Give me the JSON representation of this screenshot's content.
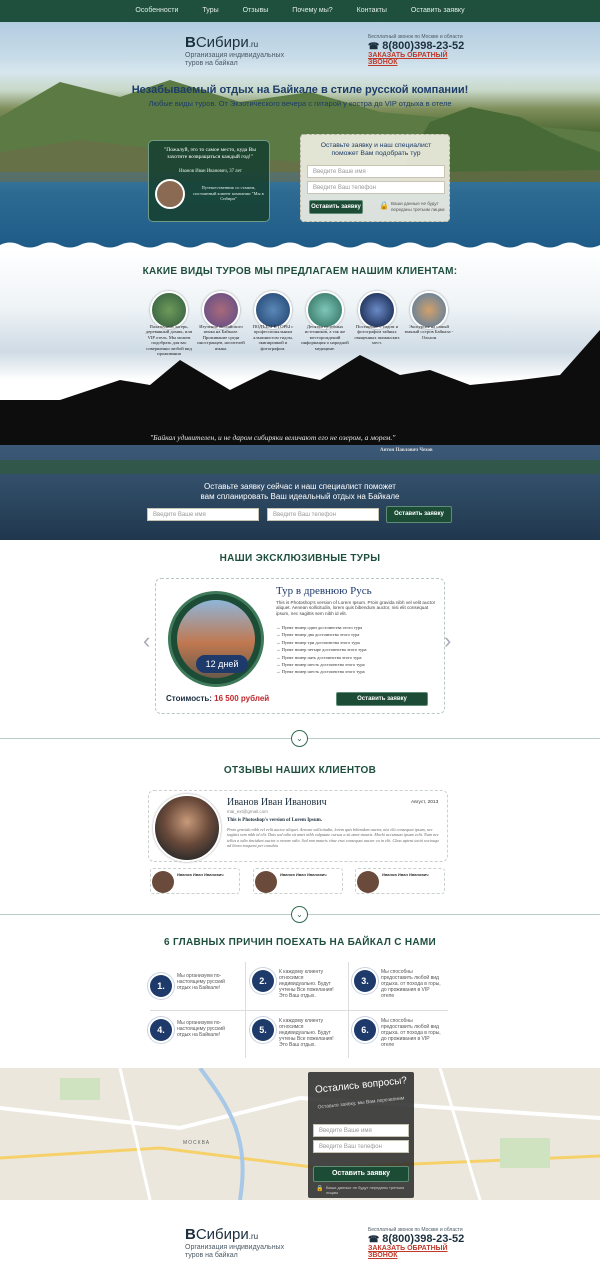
{
  "nav": [
    "Особенности",
    "Туры",
    "Отзывы",
    "Почему мы?",
    "Контакты",
    "Оставить заявку"
  ],
  "brand": {
    "b": "В",
    "name": "Сибири",
    "ru": ".ru",
    "tag1": "Организация индивидуальных",
    "tag2": "туров на байкал",
    "phone_note": "Бесплатный звонок по Москве и области",
    "phone": "8(800)398-23-52",
    "callback": "ЗАКАЗАТЬ ОБРАТНЫЙ ЗВОНОК"
  },
  "hero": {
    "title": "Незабываемый отдых на Байкале в стиле русской компании!",
    "subtitle": "Любые виды туров. От Экзотического вечера с гитарой у костра до VIP отдыха в отеле",
    "quote": "\"Пожалуй, это то самое место, куда Вы захотите возвращаться каждый год!\"",
    "person": "Иванов Иван Иванович, 37 лет",
    "person_desc": "Путешественник со стажем, постоянный клиент компании \"Мы в Сибири\"",
    "form_title": "Оставьте заявку и наш специалист поможет Вам подобрать тур",
    "name_ph": "Введите Ваше имя",
    "phone_ph": "Введите Ваш телефон",
    "button": "Оставить заявку",
    "privacy": "Ваши данные не будут переданы третьим лицам"
  },
  "tours_section": {
    "title": "КАКИЕ ВИДЫ ТУРОВ МЫ ПРЕДЛАГАЕМ НАШИМ КЛИЕНТАМ:",
    "items": [
      "Палаточный лагерь, деревянный домик, или VIP отель. Мы можем подобрать для вас совершенно любой вид проживания",
      "Изучение английского языка на Байкале. Проживание среди иностранцев, носителей языка.",
      "ПОДЪЕМ В ГОРЫ с профессиональным альпинистом гидом, экипировкой и фотографом.",
      "Десятки целебных источников, а так же месторождений информация о народной медицине.",
      "Посещение с гидом и фотографом тайных священных шаманских мест.",
      "Экскурсия на самый южный остров Байкала - Ольхон"
    ],
    "quote": "\"Байкал удивителен, и не даром сибиряки величают его не озером, а морем.\"",
    "quote_author": "Антон Павлович Чехов",
    "form_title1": "Оставьте заявку сейчас и наш специалист поможет",
    "form_title2": "вам спланировать Ваш идеальный отдых на Байкале",
    "name_ph": "Введите Ваше имя",
    "phone_ph": "Введите Ваш телефон",
    "button": "Оставить заявку"
  },
  "exclusive": {
    "title": "НАШИ ЭКСКЛЮЗИВНЫЕ ТУРЫ",
    "tour_name": "Тур в древнюю Русь",
    "desc": "This is Photoshop's version of Lorem Ipsum. Proin gravida nibh vel velit auctor aliquet. Aenean sollicitudin, lorem quis bibendum auctor, nisi elit consequat ipsum, nec sagittis sem nibh id elit.",
    "bullets": [
      "Пункт номер один достоинства этого тура",
      "Пункт номер два достоинства этого тура",
      "Пункт номер три достоинства этого тура",
      "Пункт номер четыре достоинства этого тура",
      "Пункт номер пять достоинства этого тура",
      "Пункт номер шесть достоинства этого тура",
      "Пункт номер шесть достоинства этого тура"
    ],
    "days": "12 дней",
    "price_label": "Стоимость:",
    "price": "16 500 рублей",
    "button": "Оставить заявку"
  },
  "reviews": {
    "title": "ОТЗЫВЫ НАШИХ КЛИЕНТОВ",
    "name": "Иванов Иван Иванович",
    "email": "mai_ext@gmail.com",
    "date": "Август, 2013",
    "headline": "This is Photoshop's version  of Lorem Ipsum.",
    "text": "Proin gravida nibh vel velit auctor aliquet. Aenean sollicitudin, lorem quis bibendum auctor, nisi elit consequat ipsum, nec sagittis sem nibh id elit. Duis sed odio sit amet nibh vulputate cursus a sit amet mauris. Morbi accumsan ipsum velit. Nam nec tellus a odio tincidunt auctor a ornare odio. Sed non mauris vitae erat consequat auctor eu in elit. Class aptent taciti sociosqu ad litora torquent per conubia",
    "mini_name": "Иванов Иван Иванович"
  },
  "reasons": {
    "title": "6 ГЛАВНЫХ ПРИЧИН ПОЕХАТЬ НА БАЙКАЛ С НАМИ",
    "items": [
      {
        "n": "1.",
        "t": "Мы организуем по-настоящему русский отдых на Байкале!"
      },
      {
        "n": "2.",
        "t": "К каждому клиенту относимся индивидуально. Будут учтены Все пожелания! Это Ваш отдых."
      },
      {
        "n": "3.",
        "t": "Мы способны предоставить любой вид отдыха. от похода в горы, до проживания в VIP отеле"
      },
      {
        "n": "4.",
        "t": "Мы организуем по-настоящему русский отдых на Байкале!"
      },
      {
        "n": "5.",
        "t": "К каждому клиенту относимся индивидуально. Будут учтены Все пожелания! Это Ваш отдых."
      },
      {
        "n": "6.",
        "t": "Мы способны предоставить любой вид отдыха. от похода в горы, до проживания в VIP отеле"
      }
    ]
  },
  "contact": {
    "title": "Остались вопросы?",
    "subtitle": "Оставьте заявку, мы Вам перезвоним",
    "name_ph": "Введите Ваше имя",
    "phone_ph": "Введите Ваш телефон",
    "button": "Оставить заявку",
    "privacy": "Ваши данные не будут переданы третьим лицам",
    "map_label": "МОСКВА"
  }
}
